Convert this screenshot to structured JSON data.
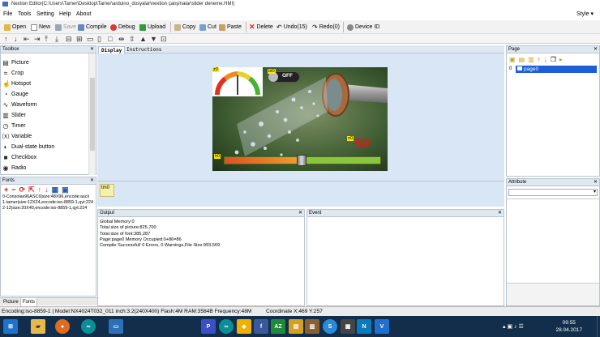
{
  "window": {
    "title": "Nextion Editor(C:\\Users\\Tamer\\Desktop\\Tamer\\arduino_dosyalar\\nextion çalışmalar\\slider deneme.HMI)"
  },
  "menu": {
    "items": [
      "File",
      "Tools",
      "Setting",
      "Help",
      "About"
    ],
    "style_label": "Style"
  },
  "toolbar": {
    "open": "Open",
    "new": "New",
    "save": "Save",
    "compile": "Compile",
    "debug": "Debug",
    "upload": "Upload",
    "copy": "Copy",
    "cut": "Cut",
    "paste": "Paste",
    "delete": "Delete",
    "undo": "Undo(15)",
    "redo": "Redo(0)",
    "device_id": "Device  ID"
  },
  "toolbox": {
    "title": "Toolbox",
    "items": [
      "Picture",
      "Crop",
      "Hotspot",
      "Gauge",
      "Waveform",
      "Slider",
      "Timer",
      "Variable",
      "Dual-state button",
      "Checkbox",
      "Radio"
    ]
  },
  "fonts": {
    "title": "Fonts",
    "lines": [
      "0-Consolas96ASCII|size:48X96,encode:ascii",
      "1-tamer|size:12X24,encode:iso-8859-1,qyt:224",
      "2-12|size:20X40,encode:iso-8859-1,qyt:224"
    ]
  },
  "bottom_tabs": [
    "Picture",
    "Fonts"
  ],
  "design_tabs": [
    "Display",
    "Instructions"
  ],
  "screen": {
    "badge_z0": "z0",
    "badge_bt0": "bt0",
    "toggle_label": "OFF",
    "badge_n0": "n0",
    "value": "50",
    "badge_h0": "h0",
    "slider_fraction": 0.5
  },
  "timer": {
    "label": "tm0"
  },
  "output": {
    "title": "Output",
    "lines": [
      "Global Memory:0",
      "Total size of picture:825,700",
      "Total size of font:385,287",
      "Page:page0 Memory Occupied:0+86=86",
      "Compile Successful! 0 Errors, 0 Warnings,File Size:993,569"
    ]
  },
  "event": {
    "title": "Event"
  },
  "page_panel": {
    "title": "Page",
    "items": [
      {
        "index": "0",
        "name": "page0"
      }
    ]
  },
  "attribute": {
    "title": "Attribute"
  },
  "statusbar": {
    "info": "Encoding:iso-8859-1 | Model:NX4024T032_011  inch:3.2(240X400) Flash:4M RAM:3584B Frequency:48M",
    "coords": "Coordinate X:469  Y:257"
  },
  "taskbar": {
    "time": "09:55",
    "date": "28.04.2017"
  },
  "colors": {
    "panel_header": "#dfe7f1",
    "canvas_bg": "#d9e6f6",
    "selected": "#1c5fd6",
    "taskbar": "#132e4b"
  }
}
